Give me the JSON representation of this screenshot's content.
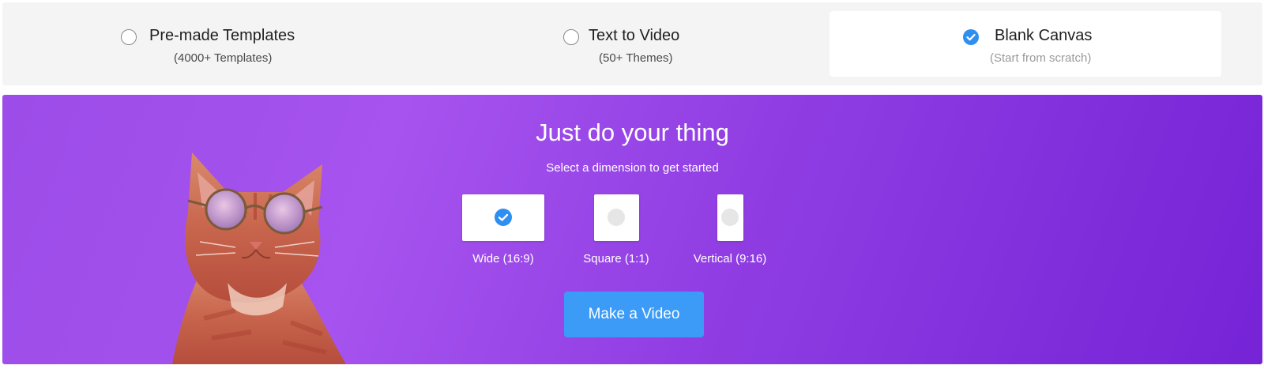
{
  "modes": [
    {
      "title": "Pre-made Templates",
      "sub": "(4000+ Templates)",
      "selected": false
    },
    {
      "title": "Text to Video",
      "sub": "(50+ Themes)",
      "selected": false
    },
    {
      "title": "Blank Canvas",
      "sub": "(Start from scratch)",
      "selected": true
    }
  ],
  "panel": {
    "title": "Just do your thing",
    "subtitle": "Select a dimension to get started",
    "dimensions": [
      {
        "label": "Wide (16:9)",
        "selected": true
      },
      {
        "label": "Square (1:1)",
        "selected": false
      },
      {
        "label": "Vertical (9:16)",
        "selected": false
      }
    ],
    "cta_label": "Make a Video"
  },
  "colors": {
    "accent_blue": "#2f8ff0",
    "button_blue": "#3b9bf6",
    "panel_purple_start": "#a653ef",
    "panel_purple_end": "#7523d6",
    "bar_gray": "#f4f4f4"
  }
}
